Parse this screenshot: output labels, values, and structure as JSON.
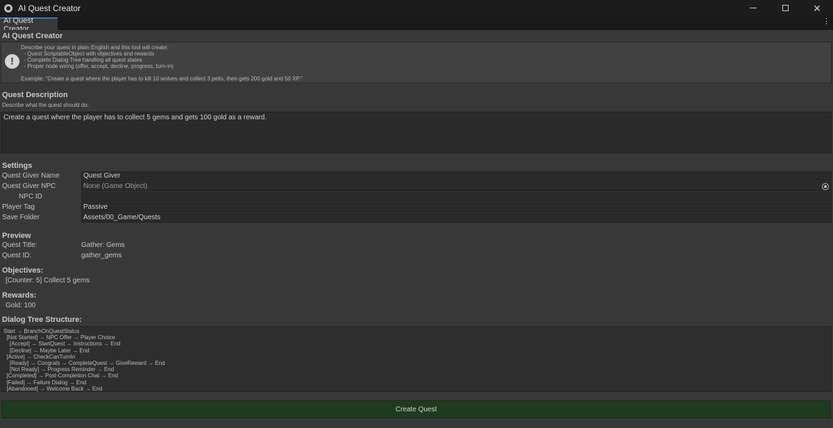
{
  "window": {
    "title": "AI Quest Creator"
  },
  "tab": {
    "label": "AI Quest Creator"
  },
  "panel": {
    "header": "AI Quest Creator"
  },
  "help": {
    "line1": "Describe your quest in plain English and this tool will create:",
    "line2": "  - Quest ScriptableObject with objectives and rewards",
    "line3": "  - Complete Dialog Tree handling all quest states",
    "line4": "  - Proper node wiring (offer, accept, decline, progress, turn-in)",
    "example": "Example: \"Create a quest where the player has to kill 10 wolves and collect 3 pelts, then gets 200 gold and 50 XP.\""
  },
  "description": {
    "header": "Quest Description",
    "prompt": "Describe what the quest should do:",
    "value": "Create a quest where the player has to collect 5 gems and gets 100 gold as a reward."
  },
  "settings": {
    "header": "Settings",
    "quest_giver_name_label": "Quest Giver Name",
    "quest_giver_name_value": "Quest Giver",
    "quest_giver_npc_label": "Quest Giver NPC",
    "quest_giver_npc_value": "None (Game Object)",
    "npc_id_label": "NPC ID",
    "npc_id_value": "",
    "player_tag_label": "Player Tag",
    "player_tag_value": "Passive",
    "save_folder_label": "Save Folder",
    "save_folder_value": "Assets/00_Game/Quests"
  },
  "preview": {
    "header": "Preview",
    "quest_title_label": "Quest Title:",
    "quest_title_value": "Gather: Gems",
    "quest_id_label": "Quest ID:",
    "quest_id_value": "gather_gems",
    "objectives_header": "Objectives:",
    "objective_1": "[Counter: 5] Collect 5 gems",
    "rewards_header": "Rewards:",
    "reward_1": "Gold: 100",
    "dialog_header": "Dialog Tree Structure:",
    "dialog_lines": [
      "Start → BranchOnQuestStatus",
      "  [Not Started] → NPC Offer → Player Choice",
      "    [Accept] → StartQuest → Instructions → End",
      "    [Decline] → Maybe Later → End",
      "  [Active] → CheckCanTurnIn",
      "    [Ready] → Congrats → CompleteQuest → GiveReward → End",
      "    [Not Ready] → Progress Reminder → End",
      "  [Completed] → Post-Completion Chat → End",
      "  [Failed] → Failure Dialog → End",
      "  [Abandoned] → Welcome Back → End"
    ]
  },
  "actions": {
    "create_label": "Create Quest"
  },
  "icons": {
    "app": "unity-logo-icon",
    "help": "info-icon",
    "picker": "object-picker-icon",
    "menu": "kebab-menu-icon"
  },
  "colors": {
    "accent_tab": "#3a79bb",
    "create_button": "#1e3a1f"
  }
}
